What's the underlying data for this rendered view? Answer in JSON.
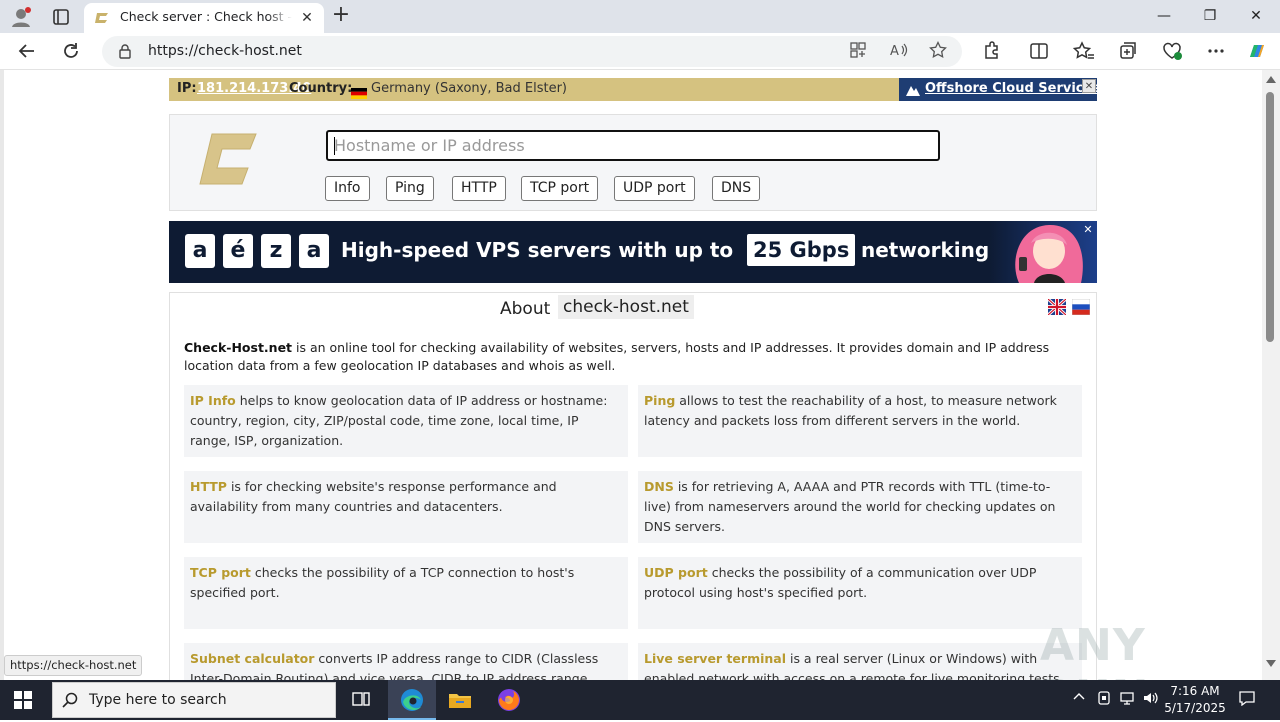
{
  "browser": {
    "tab_title": "Check server : Check host - online website monitoring",
    "tab_close": "✕",
    "new_tab": "+",
    "url": "https://check-host.net",
    "min": "—",
    "max": "❐",
    "close": "✕"
  },
  "ipbar": {
    "ip_label": "IP:",
    "ip_value": "181.214.173.40",
    "country_label": "Country:",
    "country_value": "Germany (Saxony, Bad Elster)",
    "offshore_text": "Offshore Cloud Services",
    "close": "✕"
  },
  "search": {
    "placeholder": "Hostname or IP address",
    "buttons": [
      "Info",
      "Ping",
      "HTTP",
      "TCP port",
      "UDP port",
      "DNS"
    ]
  },
  "banner": {
    "letters": [
      "a",
      "é",
      "z",
      "a"
    ],
    "text": "High-speed VPS servers with up to",
    "speed": "25 Gbps",
    "suffix": "networking",
    "close": "✕"
  },
  "about": {
    "title": "About",
    "host": "check-host.net",
    "intro_bold": "Check-Host.net",
    "intro_rest": " is an online tool for checking availability of websites, servers, hosts and IP addresses. It provides domain and IP address location data from a few geolocation IP databases and whois as well.",
    "cards": [
      {
        "name": "IP Info",
        "text": " helps to know geolocation data of IP address or hostname: country, region, city, ZIP/postal code, time zone, local time, IP range, ISP, organization."
      },
      {
        "name": "Ping",
        "text": " allows to test the reachability of a host, to measure network latency and packets loss from different servers in the world."
      },
      {
        "name": "HTTP",
        "text": " is for checking website's response performance and availability from many countries and datacenters."
      },
      {
        "name": "DNS",
        "text": " is for retrieving A, AAAA and PTR records with TTL (time-to-live) from nameservers around the world for checking updates on DNS servers."
      },
      {
        "name": "TCP port",
        "text": " checks the possibility of a TCP connection to host's specified port."
      },
      {
        "name": "UDP port",
        "text": " checks the possibility of a communication over UDP protocol using host's specified port."
      },
      {
        "name": "Subnet calculator",
        "text": " converts IP address range to CIDR (Classless Inter-Domain Routing) and vice versa, CIDR to IP address range."
      },
      {
        "name": "Live server terminal",
        "text": " is a real server (Linux or Windows) with enabled network with access on a remote for live monitoring tests."
      }
    ]
  },
  "status_url": "https://check-host.net",
  "watermark": "ANY RUN",
  "taskbar": {
    "search_placeholder": "Type here to search",
    "time": "7:16 AM",
    "date": "5/17/2025"
  },
  "colors": {
    "accent_gold": "#b89a2e",
    "ipbar": "#d5c280",
    "offshore": "#1e3d73",
    "banner_bg": "#0e1b33"
  }
}
